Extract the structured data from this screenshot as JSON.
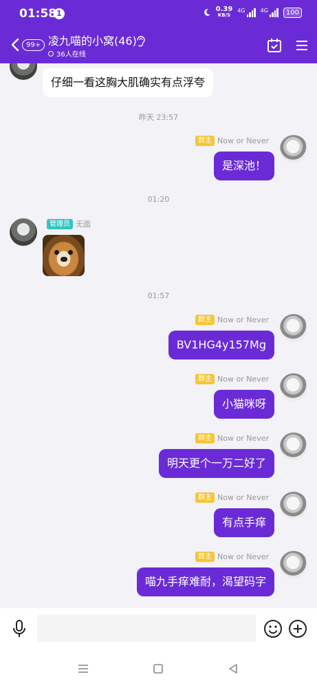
{
  "status_bar": {
    "time": "01:58",
    "notification_count": "1",
    "speed_value": "0.39",
    "speed_unit": "KB/S",
    "network_1": "4G",
    "network_2": "4G",
    "battery": "100"
  },
  "header": {
    "unread_badge": "99+",
    "title": "凌九喵的小窝(46)",
    "online_text": "36人在线",
    "icons": [
      "back-icon",
      "ear-icon",
      "calendar-icon",
      "menu-icon"
    ]
  },
  "messages": {
    "m0": {
      "text": "仔细一看这胸大肌确实有点浮夸"
    },
    "ts1": "昨天 23:57",
    "m1": {
      "tag": "群主",
      "sender": "Now or Never",
      "text": "是深池！"
    },
    "ts2": "01:20",
    "m2": {
      "tag": "管理员",
      "sender": "无面",
      "content": "doge-sticker"
    },
    "ts3": "01:57",
    "m3": {
      "tag": "群主",
      "sender": "Now or Never",
      "text": "BV1HG4y157Mg"
    },
    "m4": {
      "tag": "群主",
      "sender": "Now or Never",
      "text": "小猫咪呀"
    },
    "m5": {
      "tag": "群主",
      "sender": "Now or Never",
      "text": "明天更个一万二好了"
    },
    "m6": {
      "tag": "群主",
      "sender": "Now or Never",
      "text": "有点手痒"
    },
    "m7": {
      "tag": "群主",
      "sender": "Now or Never",
      "text": "喵九手痒难耐，渴望码字"
    }
  },
  "composer": {
    "input_value": "",
    "icons": [
      "microphone-icon",
      "emoji-icon",
      "plus-icon"
    ]
  },
  "nav": {
    "icons": [
      "recent-apps-icon",
      "home-icon",
      "back-triangle-icon"
    ]
  },
  "colors": {
    "accent": "#6a2bd7",
    "owner_tag": "#f7c535",
    "admin_tag": "#2ec5c4"
  }
}
